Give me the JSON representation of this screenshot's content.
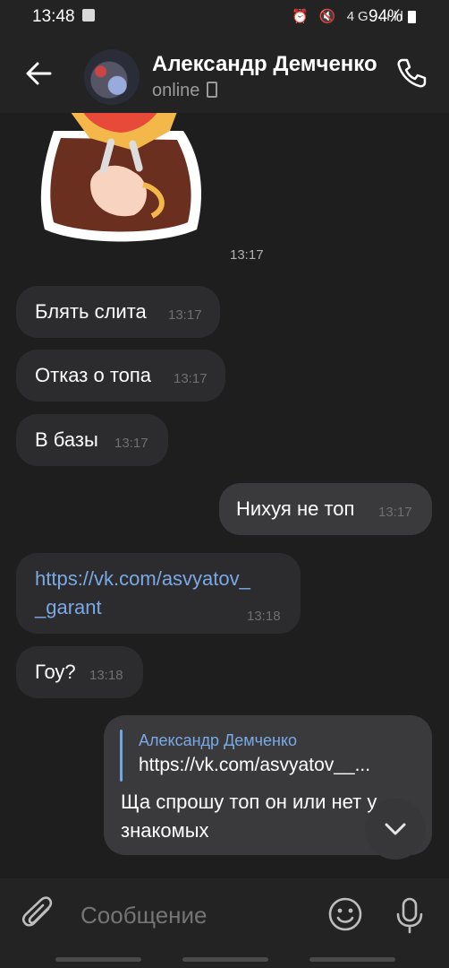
{
  "status_bar": {
    "time": "13:48",
    "battery": "94%",
    "icons": "⏰ 🔇 4G .ıll"
  },
  "header": {
    "name": "Александр Демченко",
    "status": "online"
  },
  "messages": [
    {
      "kind": "sticker",
      "time": "13:17"
    },
    {
      "dir": "in",
      "text": "Блять слита",
      "time": "13:17"
    },
    {
      "dir": "in",
      "text": "Отказ о топа",
      "time": "13:17"
    },
    {
      "dir": "in",
      "text": "В базы",
      "time": "13:17"
    },
    {
      "dir": "out",
      "text": "Нихуя не топ",
      "time": "13:17"
    },
    {
      "dir": "in",
      "link_line1": "https://vk.com/asvyatov_",
      "link_line2": "_garant",
      "time": "13:18"
    },
    {
      "dir": "in",
      "text": "Гоу?",
      "time": "13:18"
    },
    {
      "dir": "out",
      "reply_name": "Александр Демченко",
      "reply_text": "https://vk.com/asvyatov__...",
      "text_line1": "Ща спрошу топ он или нет у",
      "text_line2": "знакомых"
    }
  ],
  "composer": {
    "placeholder": "Сообщение"
  },
  "colors": {
    "background": "#1e1e1f",
    "bubble_in": "#2c2c2e",
    "bubble_out": "#3a3a3c",
    "link": "#7aa9e6",
    "bars": "#232323"
  }
}
